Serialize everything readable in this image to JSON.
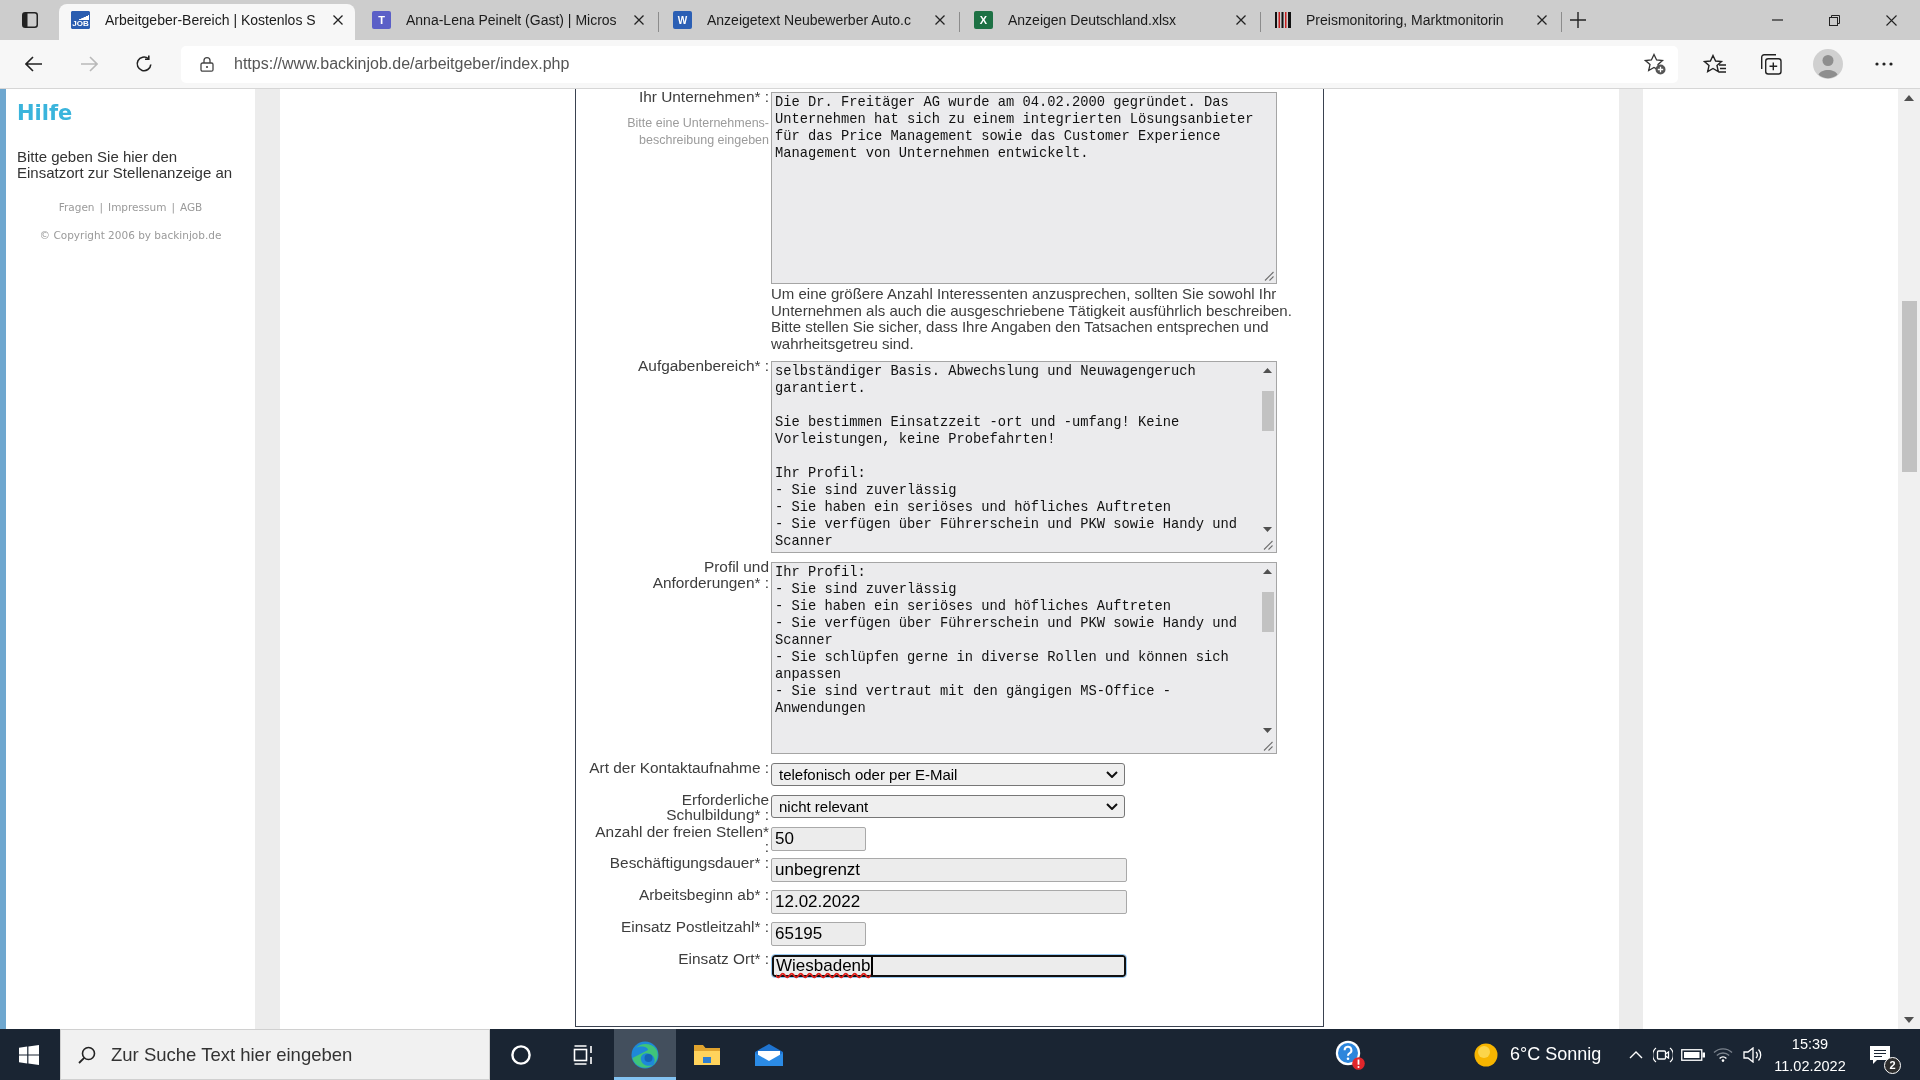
{
  "browser": {
    "tabs": [
      {
        "kind": "job",
        "favicon_text": "JOB",
        "title": "Arbeitgeber-Bereich | Kostenlos S",
        "selected": true
      },
      {
        "kind": "teams",
        "favicon_text": "T",
        "title": "Anna-Lena Peinelt (Gast) | Micros",
        "selected": false
      },
      {
        "kind": "word",
        "favicon_text": "W",
        "title": "Anzeigetext Neubewerber Auto.c",
        "selected": false
      },
      {
        "kind": "excel",
        "favicon_text": "X",
        "title": "Anzeigen Deutschland.xlsx",
        "selected": false
      },
      {
        "kind": "stripes",
        "title": "Preismonitoring, Marktmonitorin",
        "selected": false
      }
    ],
    "address_bar": {
      "url": "https://www.backinjob.de/arbeitgeber/index.php"
    }
  },
  "sidebar": {
    "title": "Hilfe",
    "text": "Bitte geben Sie hier den Einsatzort zur Stellenanzeige an",
    "links": [
      "Fragen",
      "Impressum",
      "AGB"
    ],
    "link_separator": "|",
    "copyright": "© Copyright 2006 by backinjob.de"
  },
  "form": {
    "fields": [
      {
        "kind": "textarea",
        "label": "Ihr Unternehmen* :",
        "hint": "Bitte eine Unternehmens-beschreibung eingeben",
        "value": "Die Dr. Freitäger AG wurde am 04.02.2000 gegründet. Das\nUnternehmen hat sich zu einem integrierten Lösungsanbieter\nfür das Price Management sowie das Customer Experience\nManagement von Unternehmen entwickelt.",
        "note": "Um eine größere Anzahl Interessenten anzusprechen, sollten Sie sowohl Ihr Unternehmen als auch die ausgeschriebene Tätigkeit ausführlich beschreiben. Bitte stellen Sie sicher, dass Ihre Angaben den Tatsachen entsprechen und wahrheitsgetreu sind.",
        "scrollbar": false,
        "focused": false,
        "misspelled": false
      },
      {
        "kind": "textarea",
        "label": "Aufgabenbereich* :",
        "value": "selbständiger Basis. Abwechslung und Neuwagengeruch\ngarantiert.\n\nSie bestimmen Einsatzzeit -ort und -umfang! Keine\nVorleistungen, keine Probefahrten!\n\nIhr Profil:\n- Sie sind zuverlässig\n- Sie haben ein seriöses und höfliches Auftreten\n- Sie verfügen über Führerschein und PKW sowie Handy und\nScanner",
        "scrollbar": true,
        "focused": false,
        "misspelled": false
      },
      {
        "kind": "textarea",
        "label": "Profil und\nAnforderungen* :",
        "value": "Ihr Profil:\n- Sie sind zuverlässig\n- Sie haben ein seriöses und höfliches Auftreten\n- Sie verfügen über Führerschein und PKW sowie Handy und\nScanner\n- Sie schlüpfen gerne in diverse Rollen und können sich\nanpassen\n- Sie sind vertraut mit den gängigen MS-Office -\nAnwendungen",
        "scrollbar": true,
        "focused": false,
        "misspelled": false
      },
      {
        "kind": "select",
        "label": "Art der Kontaktaufnahme :",
        "value": "telefonisch oder per E-Mail",
        "focused": false,
        "misspelled": false
      },
      {
        "kind": "select",
        "label": "Erforderliche\nSchulbildung* :",
        "value": "nicht relevant",
        "focused": false,
        "misspelled": false
      },
      {
        "kind": "number",
        "label": "Anzahl der freien Stellen*\n:",
        "value": "50",
        "focused": false,
        "misspelled": false
      },
      {
        "kind": "text",
        "label": "Beschäftigungsdauer* :",
        "value": "unbegrenzt",
        "focused": false,
        "misspelled": false
      },
      {
        "kind": "text",
        "label": "Arbeitsbeginn ab* :",
        "value": "12.02.2022",
        "focused": false,
        "misspelled": false
      },
      {
        "kind": "postcode",
        "label": "Einsatz Postleitzahl* :",
        "value": "65195",
        "focused": false,
        "misspelled": false
      },
      {
        "kind": "text",
        "label": "Einsatz Ort* :",
        "value": "Wiesbadenb",
        "focused": true,
        "misspelled": true
      }
    ]
  },
  "taskbar": {
    "search": {
      "placeholder": "Zur Suche Text hier eingeben"
    },
    "apps": [
      {
        "kind": "ring",
        "active": false
      },
      {
        "kind": "taskview",
        "active": false
      },
      {
        "kind": "browser",
        "active": true
      },
      {
        "kind": "folder",
        "active": false
      },
      {
        "kind": "mail",
        "active": false
      }
    ],
    "weather": "6°C Sonnig",
    "time": "15:39",
    "date": "11.02.2022",
    "notifications": "2"
  }
}
